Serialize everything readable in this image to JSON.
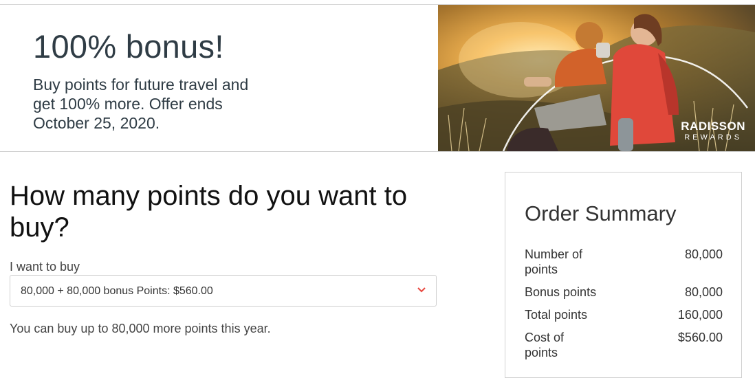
{
  "hero": {
    "title": "100% bonus!",
    "description": "Buy points for future travel and get 100% more. Offer ends October 25, 2020.",
    "brand_line1": "RADISSON",
    "brand_line2": "REWARDS"
  },
  "purchase": {
    "heading": "How many points do you want to buy?",
    "select_label": "I want to buy",
    "selected_option": "80,000 + 80,000 bonus Points: $560.00",
    "limit_note": "You can buy up to 80,000 more points this year."
  },
  "summary": {
    "title": "Order Summary",
    "rows": [
      {
        "label": "Number of points",
        "value": "80,000"
      },
      {
        "label": "Bonus points",
        "value": "80,000"
      },
      {
        "label": "Total points",
        "value": "160,000"
      },
      {
        "label": "Cost of points",
        "value": "$560.00"
      }
    ]
  },
  "colors": {
    "heading_text": "#2f3c45",
    "chevron": "#e8453c"
  },
  "icons": {
    "select_indicator": "chevron-down-icon"
  }
}
